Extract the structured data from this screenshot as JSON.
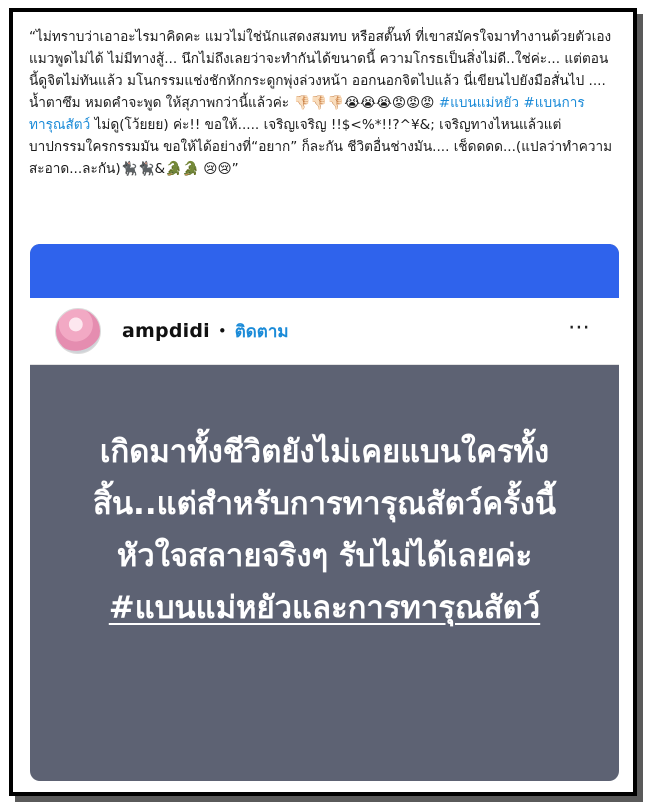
{
  "caption": {
    "body": "“ไม่ทราบว่าเอาอะไรมาคิดคะ แมวไม่ใช่นักแสดงสมทบ หรือสตั๊นท์ ที่เขาสมัครใจมาทำงานด้วยตัวเอง แมวพูดไม่ได้ ไม่มีทางสู้... นึกไม่ถึงเลยว่าจะทำกันได้ขนาดนี้ ความโกรธเป็นสิ่งไม่ดี..ใช่ค่ะ... แต่ตอนนี้ดูจิตไม่ทันแล้ว มโนกรรมแช่งชักหักกระดูกพุ่งล่วงหน้า ออกนอกจิตไปแล้ว นี่เขียนไปยังมือสั่นไป .... น้ำตาซึม หมดคำจะพูด ให้สุภาพกว่านี้แล้วค่ะ ",
    "emojis_1": "👎🏻👎🏻👎🏻😭😭😭😡😡😡 ",
    "hashtag_1": "#แบนแม่หยัว",
    "hashtag_2": "#แบนการทารุณสัตว์",
    "body_2": " ไม่ดู(โว้ยยย) ค่ะ!! ขอให้..... เจริญเจริญ !!$<%*!!?^¥&; เจริญทางไหนแล้วแต่บาปกรรมใครกรรมมัน ขอให้ได้อย่างที่“อยาก” ก็ละกัน ชีวิตอื่นช่างมัน.... เช็ดดดด...(แปลว่าทำความสะอาด...ละกัน)",
    "emojis_2": "🐈‍⬛🐈‍⬛&🐊🐊 😢😢",
    "close_quote": "”"
  },
  "post": {
    "username": "ampdidi",
    "separator": "•",
    "follow_label": "ติดตาม",
    "more_icon": "⋯",
    "story_text": "เกิดมาทั้งชีวิตยังไม่เคยแบนใครทั้งสิ้น..แต่สำหรับการทารุณสัตว์ครั้งนี้ หัวใจสลายจริงๆ รับไม่ได้เลยค่ะ ",
    "story_hashtag": "#แบนแม่หยัวและการทารุณสัตว์"
  },
  "colors": {
    "topbar": "#2f63ec",
    "card_bg": "#5d6273",
    "link": "#1b8bd8"
  }
}
